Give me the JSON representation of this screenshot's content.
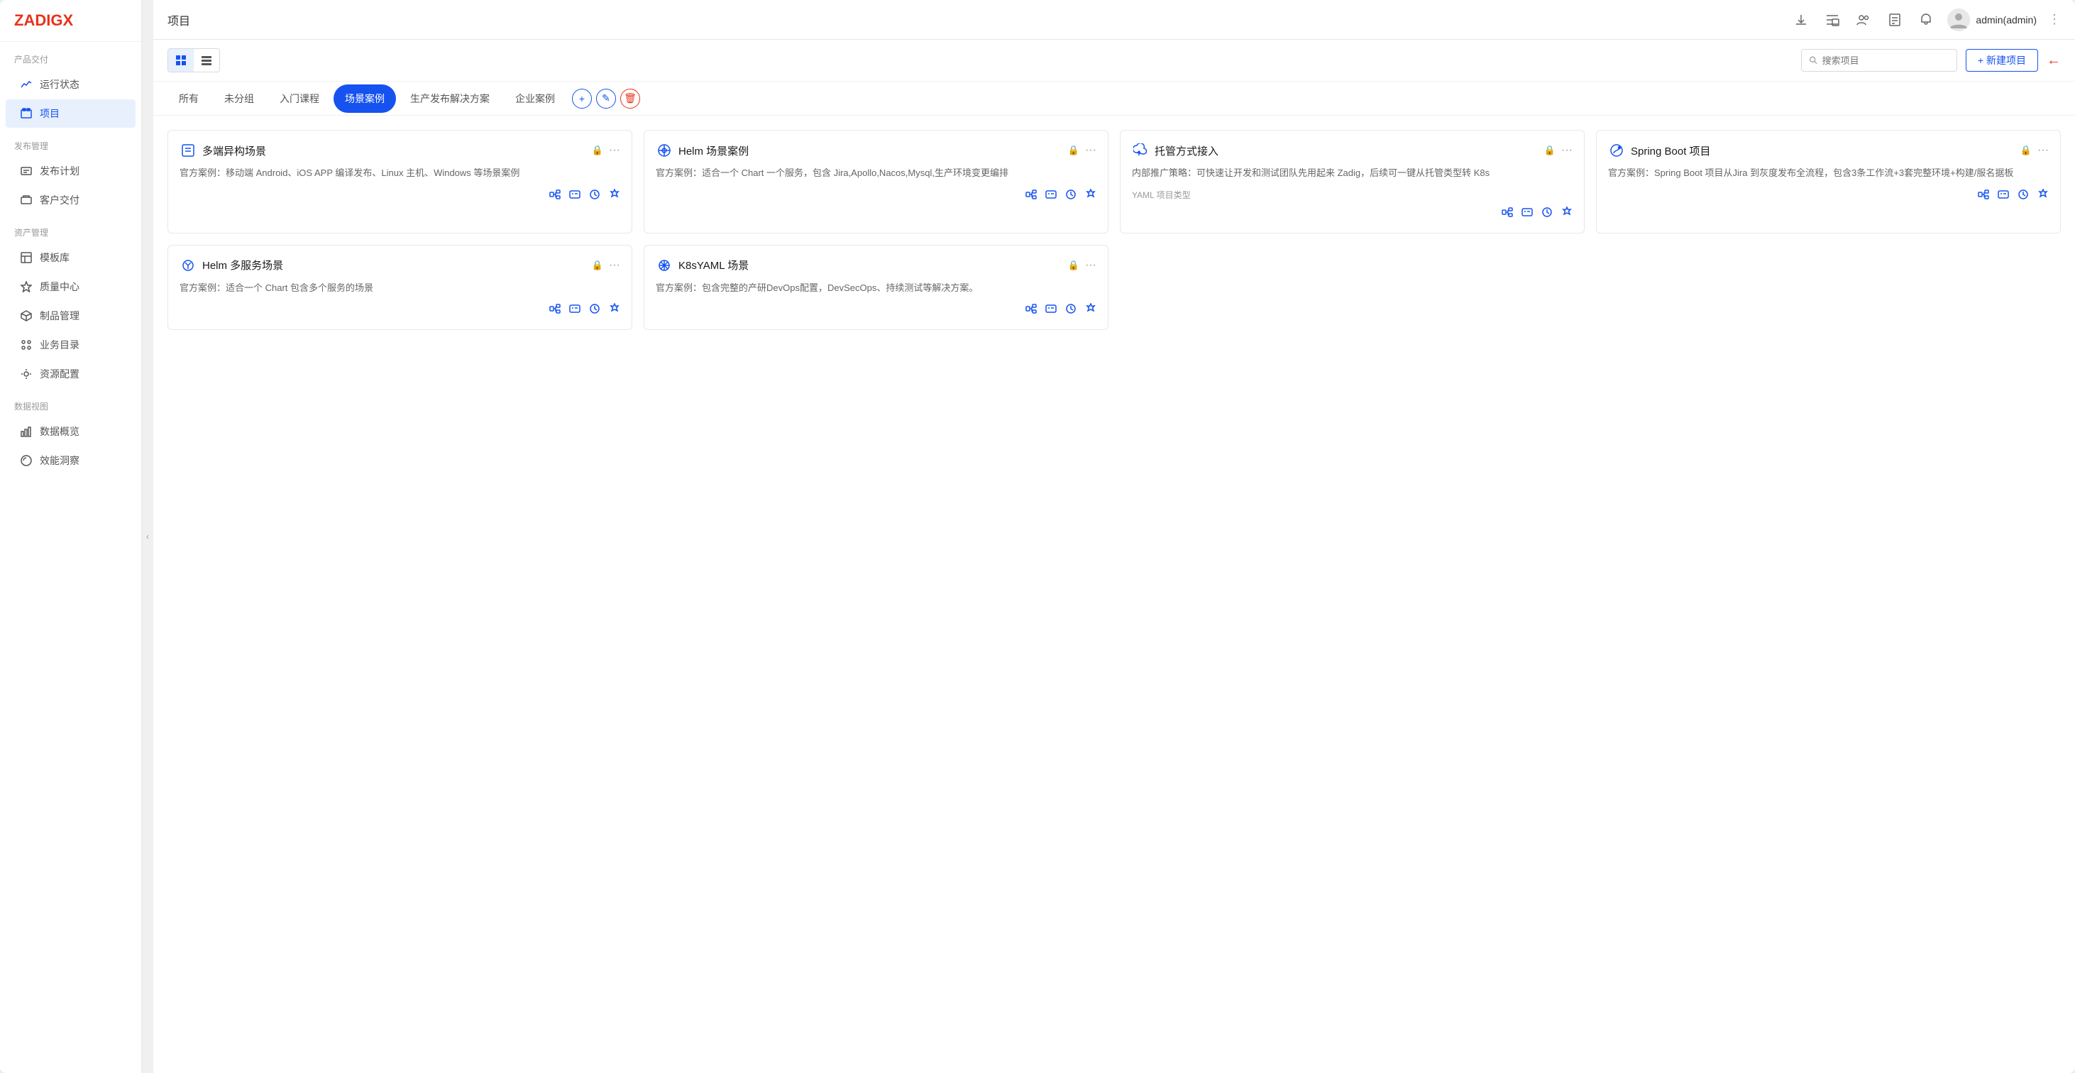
{
  "logo": {
    "text_black": "ZADIG",
    "text_red": "X"
  },
  "sidebar": {
    "section1_label": "产品交付",
    "section2_label": "发布管理",
    "section3_label": "资产管理",
    "section4_label": "数据视图",
    "items": [
      {
        "id": "yunxing",
        "label": "运行状态",
        "icon": "chart-line",
        "active": false
      },
      {
        "id": "xiangmu",
        "label": "项目",
        "icon": "project",
        "active": true
      },
      {
        "id": "fabu",
        "label": "发布计划",
        "icon": "publish",
        "active": false
      },
      {
        "id": "kehu",
        "label": "客户交付",
        "icon": "delivery",
        "active": false
      },
      {
        "id": "mubankua",
        "label": "模板库",
        "icon": "template",
        "active": false
      },
      {
        "id": "zhiliang",
        "label": "质量中心",
        "icon": "quality",
        "active": false
      },
      {
        "id": "zhipin",
        "label": "制品管理",
        "icon": "artifact",
        "active": false
      },
      {
        "id": "yewu",
        "label": "业务目录",
        "icon": "catalog",
        "active": false
      },
      {
        "id": "ziyuan",
        "label": "资源配置",
        "icon": "resource",
        "active": false
      },
      {
        "id": "shuju",
        "label": "数据概览",
        "icon": "data",
        "active": false
      },
      {
        "id": "xiaoneng",
        "label": "效能洞察",
        "icon": "insight",
        "active": false
      }
    ]
  },
  "header": {
    "title": "项目",
    "user_name": "admin(admin)",
    "more_icon": "⋮"
  },
  "toolbar": {
    "view_grid_label": "grid",
    "view_list_label": "list",
    "search_placeholder": "搜索项目",
    "new_project_label": "+ 新建项目"
  },
  "tabs": [
    {
      "id": "all",
      "label": "所有",
      "active": false
    },
    {
      "id": "ungrouped",
      "label": "未分组",
      "active": false
    },
    {
      "id": "intro",
      "label": "入门课程",
      "active": false
    },
    {
      "id": "scene",
      "label": "场景案例",
      "active": true
    },
    {
      "id": "release",
      "label": "生产发布解决方案",
      "active": false
    },
    {
      "id": "enterprise",
      "label": "企业案例",
      "active": false
    }
  ],
  "tab_actions": {
    "add": "+",
    "edit": "✎",
    "delete": "🗑"
  },
  "projects": [
    {
      "id": "multi-platform",
      "icon": "list-icon",
      "title": "多端异构场景",
      "locked": true,
      "description": "官方案例：移动端 Android、iOS APP 编译发布、Linux 主机、Windows 等场景案例",
      "tag": "",
      "actions": [
        "workflow",
        "env",
        "service",
        "config"
      ]
    },
    {
      "id": "helm-scene",
      "icon": "helm-icon",
      "title": "Helm 场景案例",
      "locked": true,
      "description": "官方案例：适合一个 Chart 一个服务，包含 Jira,Apollo,Nacos,Mysql,生产环境变更编排",
      "tag": "",
      "actions": [
        "workflow",
        "env",
        "service",
        "config"
      ]
    },
    {
      "id": "hosted-access",
      "icon": "cloud-icon",
      "title": "托管方式接入",
      "locked": true,
      "description": "内部推广策略：可快速让开发和测试团队先用起来 Zadig，后续可一键从托管类型转 K8s",
      "tag": "YAML 项目类型",
      "actions": [
        "workflow",
        "env",
        "service",
        "config"
      ]
    },
    {
      "id": "spring-boot",
      "icon": "spring-icon",
      "title": "Spring Boot 项目",
      "locked": true,
      "description": "官方案例：Spring Boot 项目从Jira 到灰度发布全流程，包含3条工作流+3套完整环境+构建/服名据板",
      "tag": "",
      "actions": [
        "workflow",
        "env",
        "service",
        "config"
      ]
    },
    {
      "id": "helm-multi",
      "icon": "helm-multi-icon",
      "title": "Helm 多服务场景",
      "locked": true,
      "description": "官方案例：适合一个 Chart 包含多个服务的场景",
      "tag": "",
      "actions": [
        "workflow",
        "env",
        "service",
        "config"
      ]
    },
    {
      "id": "k8s-yaml",
      "icon": "k8s-icon",
      "title": "K8sYAML 场景",
      "locked": true,
      "description": "官方案例：包含完整的产研DevOps配置，DevSecOps、持续测试等解决方案。",
      "tag": "",
      "actions": [
        "workflow",
        "env",
        "service",
        "config"
      ]
    }
  ]
}
